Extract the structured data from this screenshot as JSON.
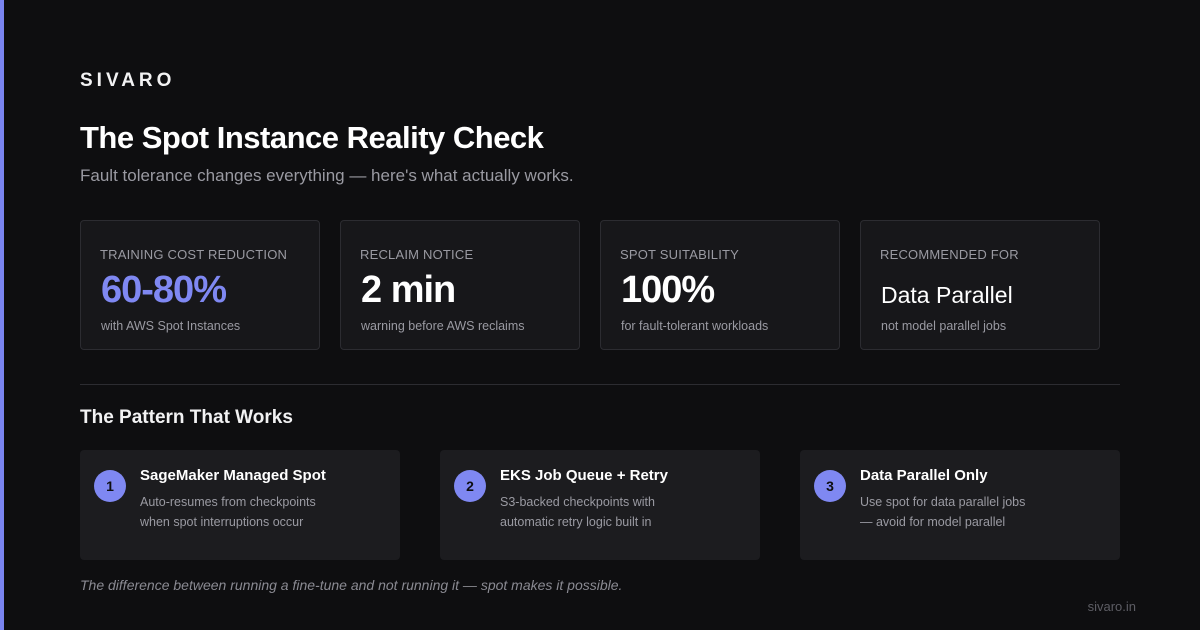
{
  "brand": "SIVARO",
  "title": "The Spot Instance Reality Check",
  "subtitle": "Fault tolerance changes everything — here's what actually works.",
  "stats": [
    {
      "label": "TRAINING COST REDUCTION",
      "value": "60-80%",
      "caption": "with AWS Spot Instances"
    },
    {
      "label": "RECLAIM NOTICE",
      "value": "2 min",
      "caption": "warning before AWS reclaims"
    },
    {
      "label": "SPOT SUITABILITY",
      "value": "100%",
      "caption": "for fault-tolerant workloads"
    },
    {
      "label": "RECOMMENDED FOR",
      "value": "Data Parallel",
      "caption": "not model parallel jobs"
    }
  ],
  "section_title": "The Pattern That Works",
  "steps": [
    {
      "number": "1",
      "title": "SageMaker Managed Spot",
      "desc_line1": "Auto-resumes from checkpoints",
      "desc_line2": "when spot interruptions occur"
    },
    {
      "number": "2",
      "title": "EKS Job Queue + Retry",
      "desc_line1": "S3-backed checkpoints with",
      "desc_line2": "automatic retry logic built in"
    },
    {
      "number": "3",
      "title": "Data Parallel Only",
      "desc_line1": "Use spot for data parallel jobs",
      "desc_line2": "— avoid for model parallel"
    }
  ],
  "footnote": "The difference between running a fine-tune and not running it — spot makes it possible.",
  "site": "sivaro.in",
  "colors": {
    "background": "#0e0e10",
    "accent": "#7f88f2",
    "card": "#17171a",
    "muted_text": "#9a9aa2"
  }
}
